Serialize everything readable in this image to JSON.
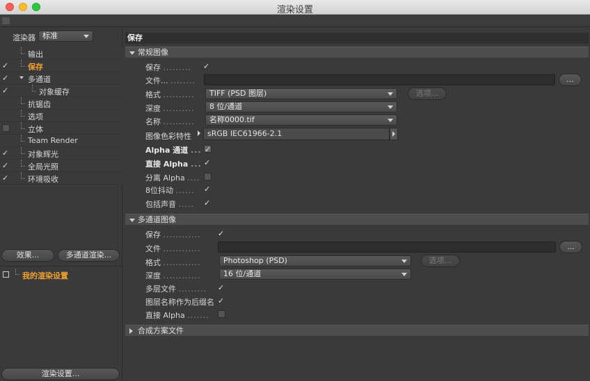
{
  "window": {
    "title": "渲染设置"
  },
  "left": {
    "renderer_label": "渲染器",
    "renderer_value": "标准",
    "tree": [
      {
        "label": "输出",
        "check": "",
        "indent": 1,
        "active": false
      },
      {
        "label": "保存",
        "check": "✓",
        "indent": 1,
        "active": true
      },
      {
        "label": "多通道",
        "check": "✓",
        "indent": 1,
        "active": false
      },
      {
        "label": "对象缓存",
        "check": "✓",
        "indent": 2,
        "active": false
      },
      {
        "label": "抗锯齿",
        "check": "",
        "indent": 1,
        "active": false
      },
      {
        "label": "选项",
        "check": "",
        "indent": 1,
        "active": false
      },
      {
        "label": "立体",
        "check": "box",
        "indent": 1,
        "active": false
      },
      {
        "label": "Team Render",
        "check": "",
        "indent": 1,
        "active": false
      },
      {
        "label": "对象辉光",
        "check": "✓",
        "indent": 1,
        "active": false
      },
      {
        "label": "全局光照",
        "check": "✓",
        "indent": 1,
        "active": false
      },
      {
        "label": "环境吸收",
        "check": "✓",
        "indent": 1,
        "active": false
      }
    ],
    "effects_button": "效果...",
    "multipass_button": "多通道渲染...",
    "render_setting_item": "我的渲染设置",
    "render_settings_button": "渲染设置..."
  },
  "main": {
    "panel_title": "保存",
    "regular": {
      "header": "常规图像",
      "save_label": "保存",
      "save_check": "✓",
      "file_label": "文件...",
      "file_value": "",
      "browse_label": "...",
      "format_label": "格式",
      "format_value": "TIFF (PSD 图层)",
      "options_label": "选项...",
      "depth_label": "深度",
      "depth_value": "8 位/通道",
      "name_label": "名称",
      "name_value": "名称0000.tif",
      "profile_label": "图像色彩特性",
      "profile_value": "sRGB IEC61966-2.1",
      "alpha_label": "Alpha 通道",
      "alpha_check": "✓",
      "straight_alpha_label": "直接 Alpha",
      "straight_alpha_check": "✓",
      "separate_alpha_label": "分离 Alpha",
      "dither_label": "8位抖动",
      "dither_check": "✓",
      "sound_label": "包括声音",
      "sound_check": "✓"
    },
    "multipass": {
      "header": "多通道图像",
      "save_label": "保存",
      "save_check": "✓",
      "file_label": "文件",
      "browse_label": "...",
      "format_label": "格式",
      "format_value": "Photoshop (PSD)",
      "options_label": "选项...",
      "depth_label": "深度",
      "depth_value": "16 位/通道",
      "layered_label": "多层文件",
      "layered_check": "✓",
      "suffix_label": "图层名称作为后缀名",
      "suffix_check": "✓",
      "straight_alpha_label": "直接 Alpha"
    },
    "composite": {
      "header": "合成方案文件"
    }
  }
}
